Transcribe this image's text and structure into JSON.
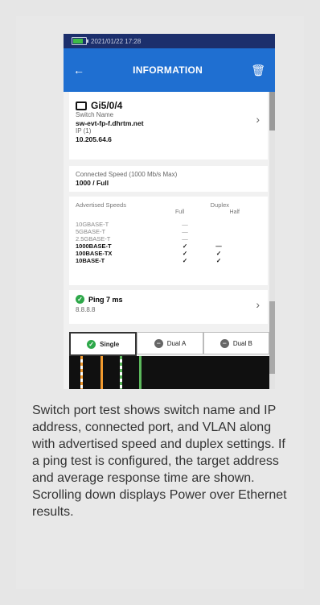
{
  "status": {
    "datetime": "2021/01/22  17:28"
  },
  "appbar": {
    "title": "INFORMATION"
  },
  "switch": {
    "port": "Gi5/0/4",
    "name_label": "Switch Name",
    "name_value": "sw-evt-fp-f.dhrtm.net",
    "ip_label": "IP (1)",
    "ip_value": "10.205.64.6"
  },
  "speed": {
    "label": "Connected Speed (1000 Mb/s Max)",
    "value": "1000 / Full"
  },
  "advertised": {
    "label": "Advertised Speeds",
    "duplex_label": "Duplex",
    "full_label": "Full",
    "half_label": "Half",
    "rows": [
      {
        "name": "10GBASE-T",
        "full": "—",
        "half": ""
      },
      {
        "name": "5GBASE-T",
        "full": "—",
        "half": ""
      },
      {
        "name": "2.5GBASE-T",
        "full": "—",
        "half": ""
      },
      {
        "name": "1000BASE-T",
        "full": "✓",
        "half": "—"
      },
      {
        "name": "100BASE-TX",
        "full": "✓",
        "half": "✓"
      },
      {
        "name": "10BASE-T",
        "full": "✓",
        "half": "✓"
      }
    ]
  },
  "ping": {
    "label": "Ping 7 ms",
    "target": "8.8.8.8"
  },
  "tabs": {
    "single": "Single",
    "dual_a": "Dual A",
    "dual_b": "Dual B"
  },
  "description": "Switch port test shows switch name and IP address, connected port, and VLAN along with advertised speed and duplex settings. If a ping test is configured, the target address and average response time are shown. Scrolling down displays Power over Ethernet results."
}
